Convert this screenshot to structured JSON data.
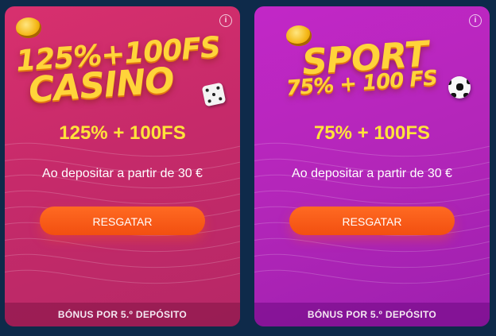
{
  "cards": [
    {
      "id": "casino",
      "hero_line1": "125%+100FS",
      "hero_line2": "CASINO",
      "bonus_amount": "125% + 100FS",
      "description": "Ao depositar a partir de 30 €",
      "button_label": "RESGATAR",
      "footer_label": "BÓNUS POR 5.º DEPÓSITO",
      "info_icon": "i",
      "accent_color": "#d8306e"
    },
    {
      "id": "sport",
      "hero_line1": "SPORT",
      "hero_line2": "75% + 100 FS",
      "bonus_amount": "75% + 100FS",
      "description": "Ao depositar a partir de 30 €",
      "button_label": "RESGATAR",
      "footer_label": "BÓNUS POR 5.º DEPÓSITO",
      "info_icon": "i",
      "accent_color": "#c227c7"
    }
  ],
  "colors": {
    "background": "#0e2a4a",
    "bonus_text": "#ffe33a",
    "button": "#f24f10"
  },
  "icons": [
    "info-icon",
    "coin-icon",
    "dice-icon",
    "soccer-ball-icon"
  ]
}
